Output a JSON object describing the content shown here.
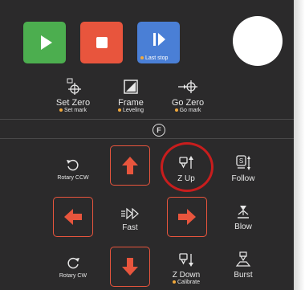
{
  "top_buttons": {
    "play": {
      "icon": "play-icon",
      "color": "#4cae4f"
    },
    "stop": {
      "icon": "stop-icon",
      "color": "#e8553d"
    },
    "resume": {
      "icon": "resume-icon",
      "color": "#4a7fd6",
      "label": "Last stop"
    }
  },
  "tools": {
    "set_zero": {
      "label": "Set Zero",
      "sub": "Set mark"
    },
    "frame": {
      "label": "Frame",
      "sub": "Leveling"
    },
    "go_zero": {
      "label": "Go Zero",
      "sub": "Go mark"
    }
  },
  "section_badge": "F",
  "controls": {
    "rotary_ccw": "Rotary CCW",
    "z_up": "Z Up",
    "follow": "Follow",
    "fast": "Fast",
    "blow": "Blow",
    "rotary_cw": "Rotary CW",
    "z_down": "Z Down",
    "z_down_sub": "Calibrate",
    "burst": "Burst"
  },
  "colors": {
    "accent": "#e8553d",
    "highlight": "#c81d1d",
    "sub_dot": "#f2a93b"
  }
}
